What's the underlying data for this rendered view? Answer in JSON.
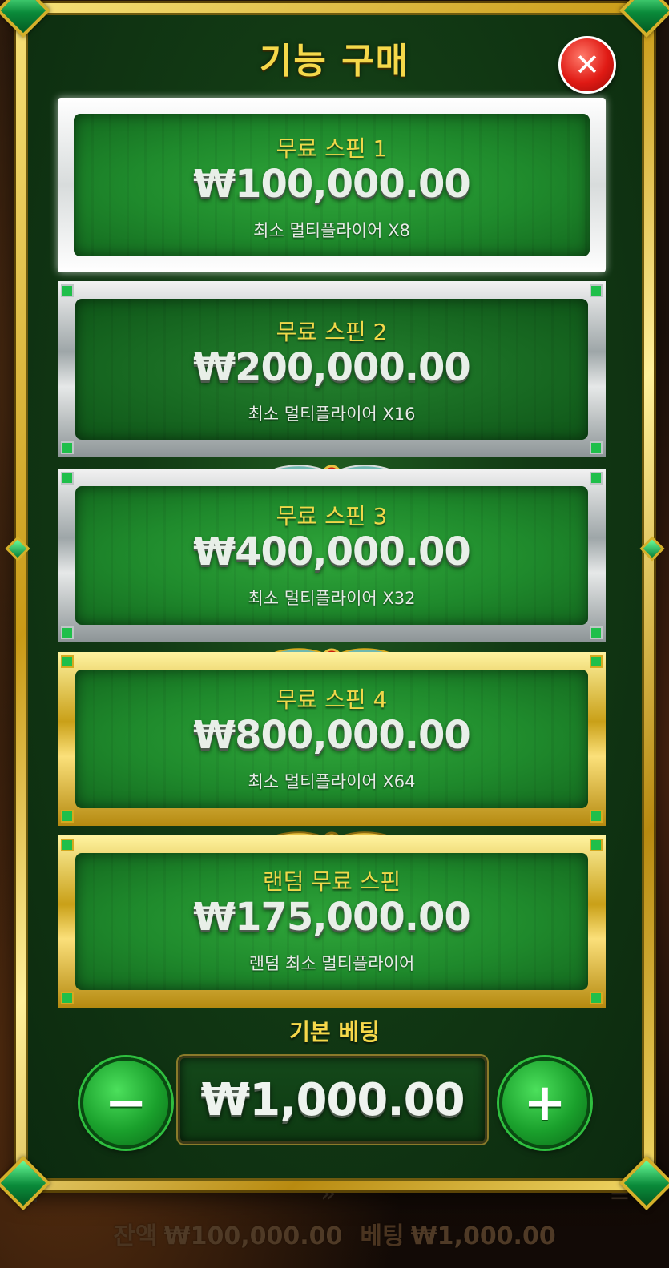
{
  "dialog": {
    "title": "기능 구매",
    "close_label": "✕"
  },
  "options": [
    {
      "name": "무료 스핀 1",
      "price": "₩100,000.00",
      "multiplier": "최소 멀티플라이어 X8",
      "selected": true
    },
    {
      "name": "무료 스핀 2",
      "price": "₩200,000.00",
      "multiplier": "최소 멀티플라이어 X16"
    },
    {
      "name": "무료 스핀 3",
      "price": "₩400,000.00",
      "multiplier": "최소 멀티플라이어 X32"
    },
    {
      "name": "무료 스핀 4",
      "price": "₩800,000.00",
      "multiplier": "최소 멀티플라이어 X64"
    },
    {
      "name": "랜덤 무료 스핀",
      "price": "₩175,000.00",
      "multiplier": "랜덤 최소 멀티플라이어"
    }
  ],
  "bet": {
    "label": "기본 베팅",
    "value": "₩1,000.00",
    "minus": "−",
    "plus": "+"
  },
  "footer": {
    "balance_label": "잔액",
    "balance_value": "₩100,000.00",
    "bet_label": "베팅",
    "bet_value": "₩1,000.00"
  },
  "colors": {
    "gold": "#f5d84a",
    "panel_green": "#123a14",
    "card_green": "#1f8a2c",
    "close_red": "#e01a14"
  }
}
